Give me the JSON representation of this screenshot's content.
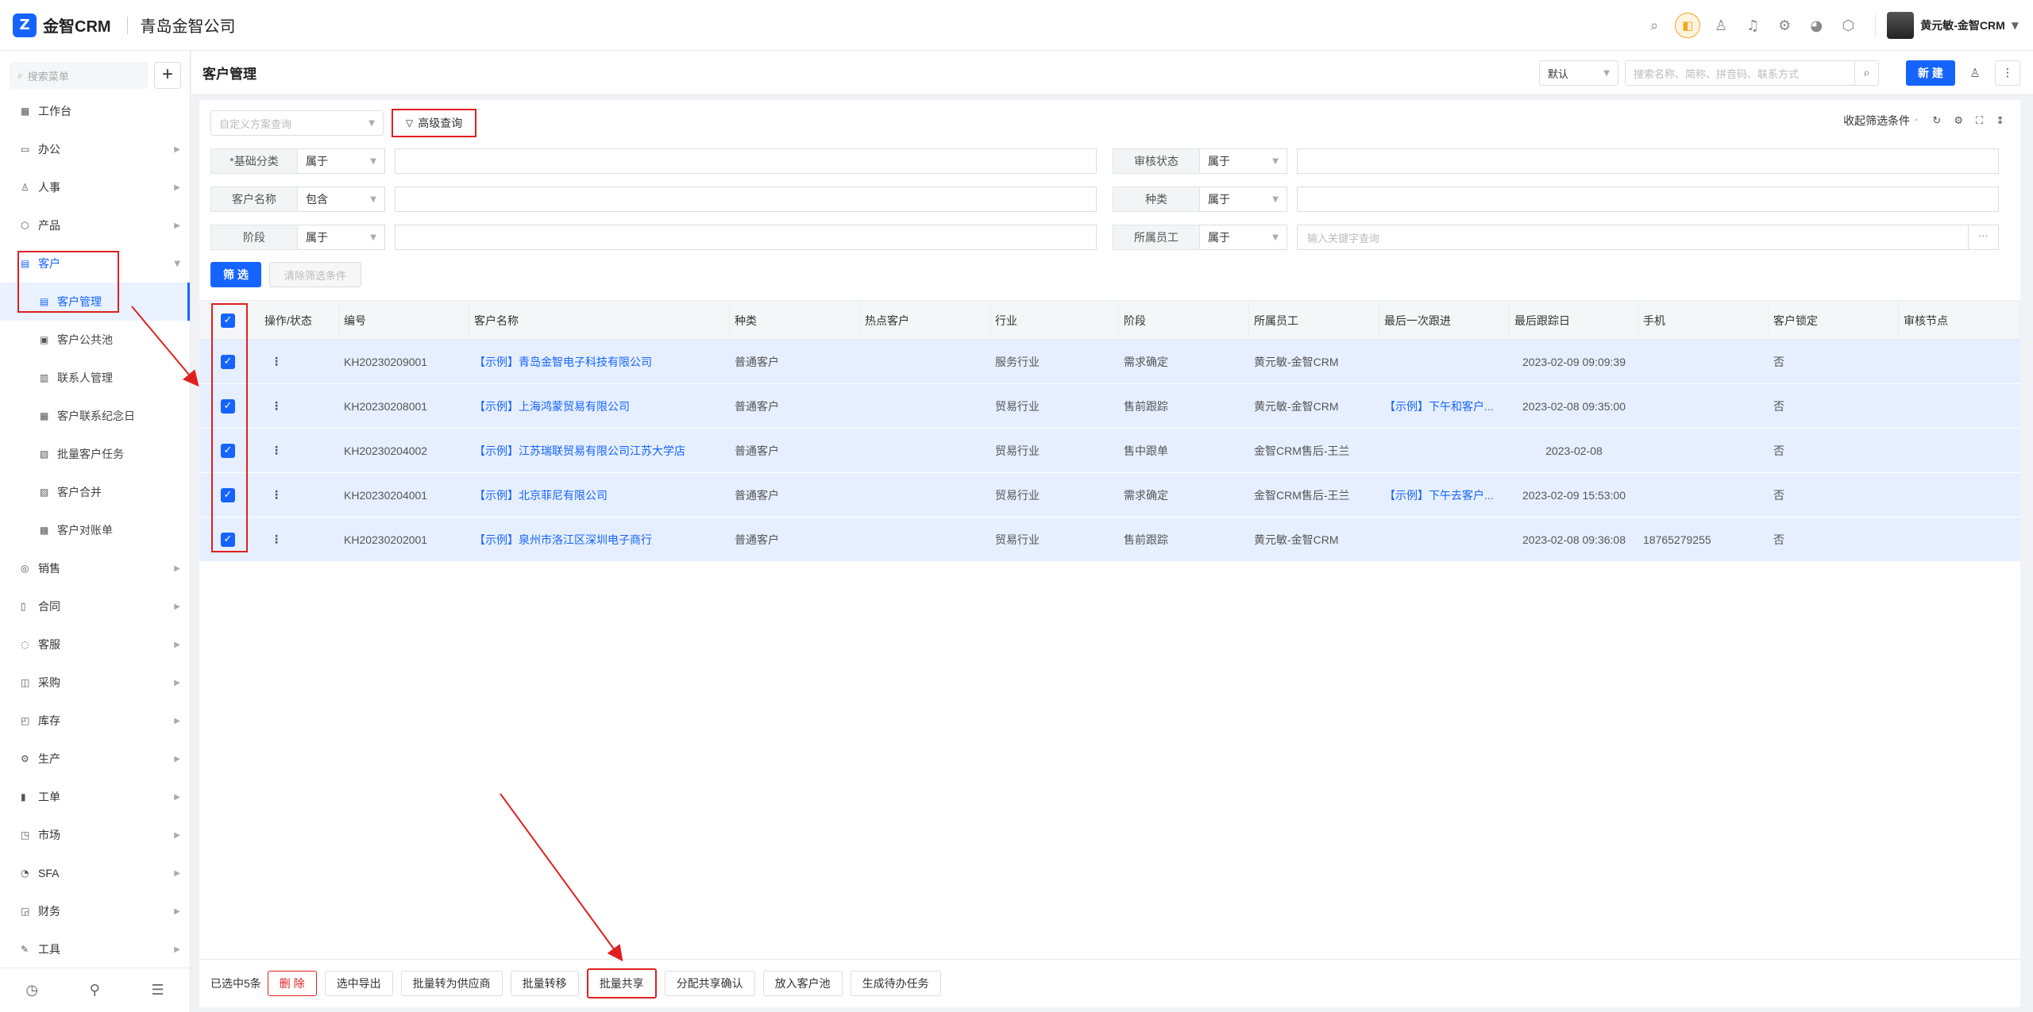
{
  "app": {
    "logo_mark": "Z",
    "name": "金智CRM",
    "company": "青岛金智公司"
  },
  "topbar": {
    "icons": [
      "search-icon",
      "voice-icon",
      "contacts-icon",
      "bell-icon",
      "settings-icon",
      "chart-icon",
      "cube-icon"
    ],
    "user_name": "黄元敏-金智CRM"
  },
  "sidebar": {
    "search_placeholder": "搜索菜单",
    "add_label": "+",
    "items": [
      {
        "label": "工作台",
        "icon": "dashboard-icon",
        "glyph": "▦",
        "arrow": false
      },
      {
        "label": "办公",
        "icon": "office-icon",
        "glyph": "▭",
        "arrow": true
      },
      {
        "label": "人事",
        "icon": "people-icon",
        "glyph": "♙",
        "arrow": true
      },
      {
        "label": "产品",
        "icon": "product-icon",
        "glyph": "⬡",
        "arrow": true
      },
      {
        "label": "客户",
        "icon": "customer-icon",
        "glyph": "▤",
        "arrow": true,
        "open": true
      },
      {
        "label": "客户管理",
        "icon": "customer-manage-icon",
        "glyph": "▤",
        "sub": true,
        "active": true
      },
      {
        "label": "客户公共池",
        "icon": "pool-icon",
        "glyph": "▣",
        "sub": true
      },
      {
        "label": "联系人管理",
        "icon": "contact-icon",
        "glyph": "▥",
        "sub": true
      },
      {
        "label": "客户联系纪念日",
        "icon": "calendar-icon",
        "glyph": "▦",
        "sub": true
      },
      {
        "label": "批量客户任务",
        "icon": "task-icon",
        "glyph": "▧",
        "sub": true
      },
      {
        "label": "客户合并",
        "icon": "merge-icon",
        "glyph": "▨",
        "sub": true
      },
      {
        "label": "客户对账单",
        "icon": "statement-icon",
        "glyph": "▩",
        "sub": true
      },
      {
        "label": "销售",
        "icon": "sales-icon",
        "glyph": "◎",
        "arrow": true
      },
      {
        "label": "合同",
        "icon": "contract-icon",
        "glyph": "▯",
        "arrow": true
      },
      {
        "label": "客服",
        "icon": "service-icon",
        "glyph": "◌",
        "arrow": true
      },
      {
        "label": "采购",
        "icon": "purchase-icon",
        "glyph": "◫",
        "arrow": true
      },
      {
        "label": "库存",
        "icon": "stock-icon",
        "glyph": "◰",
        "arrow": true
      },
      {
        "label": "生产",
        "icon": "production-icon",
        "glyph": "⚙",
        "arrow": true
      },
      {
        "label": "工单",
        "icon": "workorder-icon",
        "glyph": "▮",
        "arrow": true
      },
      {
        "label": "市场",
        "icon": "market-icon",
        "glyph": "◳",
        "arrow": true
      },
      {
        "label": "SFA",
        "icon": "sfa-icon",
        "glyph": "◔",
        "arrow": true
      },
      {
        "label": "财务",
        "icon": "finance-icon",
        "glyph": "◲",
        "arrow": true
      },
      {
        "label": "工具",
        "icon": "tool-icon",
        "glyph": "✎",
        "arrow": true
      }
    ],
    "bottom_icons": [
      "history-icon",
      "filter-settings-icon",
      "collapse-menu-icon"
    ]
  },
  "header": {
    "title": "客户管理",
    "view_select": "默认",
    "search_placeholder": "搜索名称、简称、拼音码、联系方式",
    "new_label": "新 建"
  },
  "filters": {
    "scheme_placeholder": "自定义方案查询",
    "advanced_label": "高级查询",
    "collapse_label": "收起筛选条件",
    "rows": [
      {
        "label": "*基础分类",
        "op": "属于",
        "value": ""
      },
      {
        "label": "审核状态",
        "op": "属于",
        "value": ""
      },
      {
        "label": "客户名称",
        "op": "包含",
        "value": ""
      },
      {
        "label": "种类",
        "op": "属于",
        "value": ""
      },
      {
        "label": "阶段",
        "op": "属于",
        "value": ""
      },
      {
        "label": "所属员工",
        "op": "属于",
        "value": "",
        "placeholder": "输入关键字查询"
      }
    ],
    "filter_btn": "筛 选",
    "clear_btn": "清除筛选条件"
  },
  "table": {
    "columns": [
      "操作/状态",
      "编号",
      "客户名称",
      "种类",
      "热点客户",
      "行业",
      "阶段",
      "所属员工",
      "最后一次跟进",
      "最后跟踪日",
      "手机",
      "客户锁定",
      "审核节点"
    ],
    "rows": [
      {
        "id": "KH20230209001",
        "name": "【示例】青岛金智电子科技有限公司",
        "kind": "普通客户",
        "hot": "",
        "industry": "服务行业",
        "stage": "需求确定",
        "staff": "黄元敏-金智CRM",
        "last_follow": "",
        "last_date": "2023-02-09 09:09:39",
        "phone": "",
        "locked": "否",
        "audit": ""
      },
      {
        "id": "KH20230208001",
        "name": "【示例】上海鸿蒙贸易有限公司",
        "kind": "普通客户",
        "hot": "",
        "industry": "贸易行业",
        "stage": "售前跟踪",
        "staff": "黄元敏-金智CRM",
        "last_follow": "【示例】下午和客户...",
        "last_date": "2023-02-08 09:35:00",
        "phone": "",
        "locked": "否",
        "audit": ""
      },
      {
        "id": "KH20230204002",
        "name": "【示例】江苏瑞联贸易有限公司江苏大学店",
        "kind": "普通客户",
        "hot": "",
        "industry": "贸易行业",
        "stage": "售中跟单",
        "staff": "金智CRM售后-王兰",
        "last_follow": "",
        "last_date": "2023-02-08",
        "phone": "",
        "locked": "否",
        "audit": ""
      },
      {
        "id": "KH20230204001",
        "name": "【示例】北京菲尼有限公司",
        "kind": "普通客户",
        "hot": "",
        "industry": "贸易行业",
        "stage": "需求确定",
        "staff": "金智CRM售后-王兰",
        "last_follow": "【示例】下午去客户...",
        "last_date": "2023-02-09 15:53:00",
        "phone": "",
        "locked": "否",
        "audit": ""
      },
      {
        "id": "KH20230202001",
        "name": "【示例】泉州市洛江区深圳电子商行",
        "kind": "普通客户",
        "hot": "",
        "industry": "贸易行业",
        "stage": "售前跟踪",
        "staff": "黄元敏-金智CRM",
        "last_follow": "",
        "last_date": "2023-02-08 09:36:08",
        "phone": "18765279255",
        "locked": "否",
        "audit": ""
      }
    ]
  },
  "bottombar": {
    "selected_text": "已选中5条",
    "buttons": [
      "删 除",
      "选中导出",
      "批量转为供应商",
      "批量转移",
      "批量共享",
      "分配共享确认",
      "放入客户池",
      "生成待办任务"
    ]
  },
  "colors": {
    "accent": "#1664ff",
    "annotation": "#e02020",
    "row_selected": "#e6efff"
  }
}
